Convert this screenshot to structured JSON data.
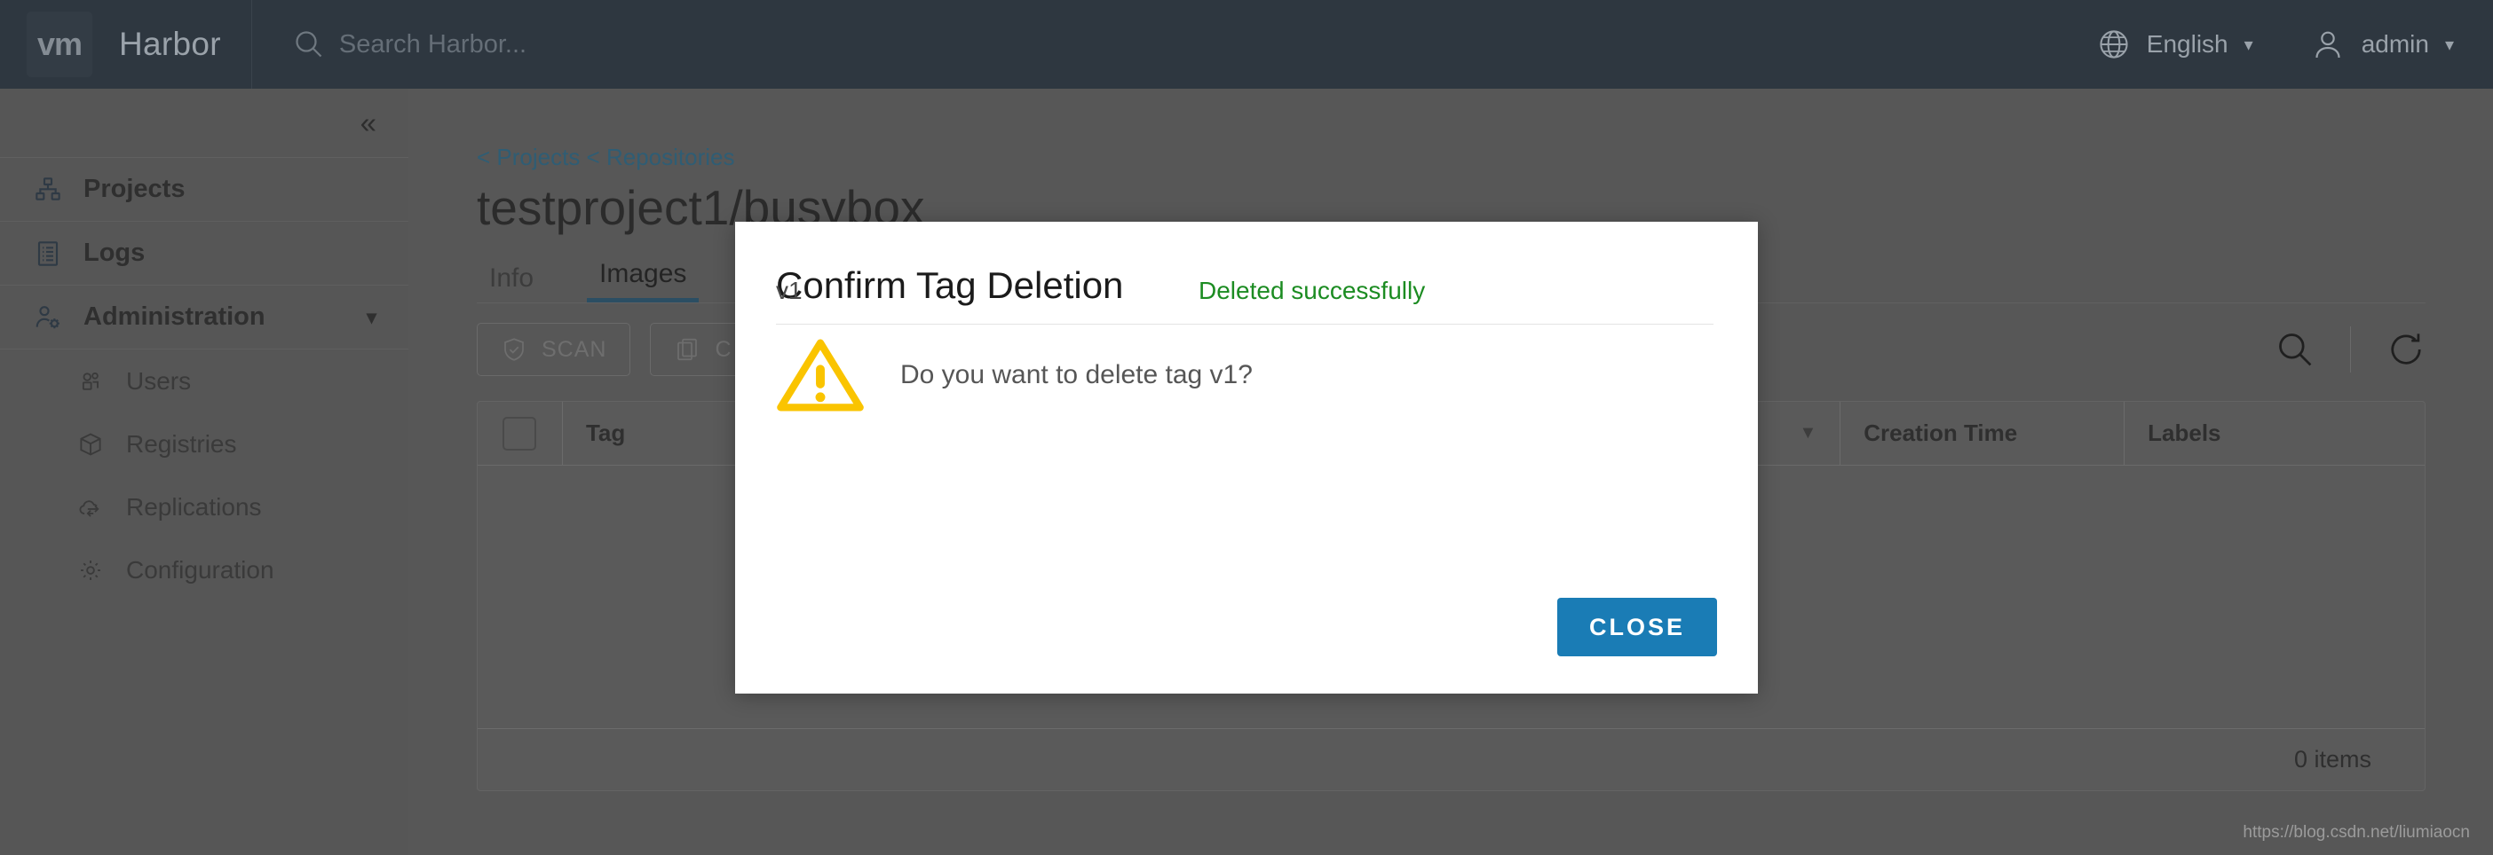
{
  "header": {
    "logo_text": "vm",
    "product": "Harbor",
    "search": {
      "placeholder": "Search Harbor...",
      "value": ""
    },
    "language": "English",
    "user": "admin"
  },
  "sidebar": {
    "collapse_label": "«",
    "items": [
      {
        "label": "Projects",
        "icon": "projects-icon",
        "level": "top"
      },
      {
        "label": "Logs",
        "icon": "logs-icon",
        "level": "top"
      },
      {
        "label": "Administration",
        "icon": "administration-icon",
        "level": "top",
        "expanded": true
      },
      {
        "label": "Users",
        "icon": "users-icon",
        "level": "sub"
      },
      {
        "label": "Registries",
        "icon": "registries-icon",
        "level": "sub"
      },
      {
        "label": "Replications",
        "icon": "replications-icon",
        "level": "sub"
      },
      {
        "label": "Configuration",
        "icon": "configuration-icon",
        "level": "sub"
      }
    ]
  },
  "main": {
    "breadcrumb": "< Projects < Repositories",
    "title": "testproject1/busybox",
    "tabs": [
      {
        "label": "Info",
        "active": false
      },
      {
        "label": "Images",
        "active": true
      }
    ],
    "toolbar": {
      "scan_label": "SCAN",
      "copy_label": "C",
      "search_icon": "search-icon",
      "refresh_icon": "refresh-icon"
    },
    "table": {
      "columns": [
        "Tag",
        "Creation Time",
        "Labels"
      ],
      "rows": [],
      "footer_count": "0 items"
    }
  },
  "modal": {
    "title": "Confirm Tag Deletion",
    "warning_icon": "warning-triangle-icon",
    "message": "Do you want to delete tag v1?",
    "status_tag": "v1",
    "status_message": "Deleted successfully",
    "close_label": "CLOSE"
  },
  "watermark": "https://blog.csdn.net/liumiaocn",
  "colors": {
    "header_bg": "#2e3740",
    "sidebar_bg": "#565656",
    "accent_blue": "#1a7cb5",
    "tab_active": "#2b4e63",
    "breadcrumb": "#2f5d74",
    "success_green": "#1c8c22",
    "warning_yellow": "#fac400"
  }
}
